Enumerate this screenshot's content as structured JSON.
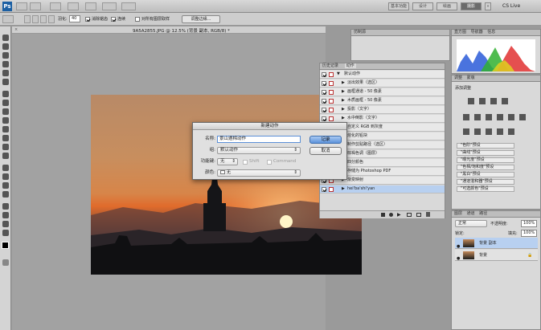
{
  "app": {
    "logo": "Ps",
    "workspaces": [
      "基本功能",
      "设计",
      "绘画",
      "摄影"
    ],
    "active_workspace": "摄影",
    "cs_live": "CS Live"
  },
  "options": {
    "feather_label": "羽化:",
    "feather_value": "40",
    "antialias_label": "消除锯齿",
    "contiguous_label": "连续",
    "all_layers_label": "对所有图层取样",
    "refine_button": "调整边缘..."
  },
  "document": {
    "title": "9A5A2855.JPG @ 12.5% (背景 副本, RGB/8) *"
  },
  "panels": {
    "info_tab": "仿制源",
    "histogram_tabs": [
      "直方图",
      "导航器",
      "信息"
    ],
    "adjust_tabs": [
      "调整",
      "蒙版"
    ],
    "adjust_add": "添加调整",
    "presets": [
      "\"色阶\"预设",
      "\"曲线\"预设",
      "\"曝光度\"预设",
      "\"色相/饱和度\"预设",
      "\"黑白\"预设",
      "\"通道混和器\"预设",
      "\"可选颜色\"预设"
    ],
    "layers_tabs": [
      "图层",
      "通道",
      "路径"
    ],
    "blend_mode": "正常",
    "opacity_label": "不透明度:",
    "opacity_value": "100%",
    "lock_label": "锁定:",
    "fill_label": "填充:",
    "fill_value": "100%",
    "layers": [
      "背景 副本",
      "背景"
    ]
  },
  "actions_panel": {
    "tabs": [
      "历史记录",
      "动作"
    ],
    "rows": [
      "默认动作",
      "淡出效果（选区）",
      "画框通道 - 50 像素",
      "木质画框 - 50 像素",
      "投影（文字）",
      "水中倒影（文字）",
      "自定义 RGB 到灰度",
      "熔化的铅块",
      "制作剪贴路径（选区）",
      "棕褐色调（图层）",
      "四分颜色",
      "存储为 Photoshop PDF",
      "渐变映射",
      "hei'ba'shi'yan"
    ]
  },
  "dialog": {
    "title": "新建动作",
    "name_label": "名称:",
    "name_value": "景山遵棉动作",
    "group_label": "组:",
    "group_value": "默认动作",
    "fkey_label": "功能键:",
    "fkey_value": "无",
    "shift_label": "Shift",
    "command_label": "Command",
    "color_label": "颜色:",
    "color_value": "无",
    "record_button": "记录",
    "cancel_button": "取消"
  },
  "histogram": {
    "colors": {
      "red": "#e03030",
      "green": "#30b030",
      "blue": "#2a5ad8",
      "yellow": "#e0d020"
    }
  }
}
